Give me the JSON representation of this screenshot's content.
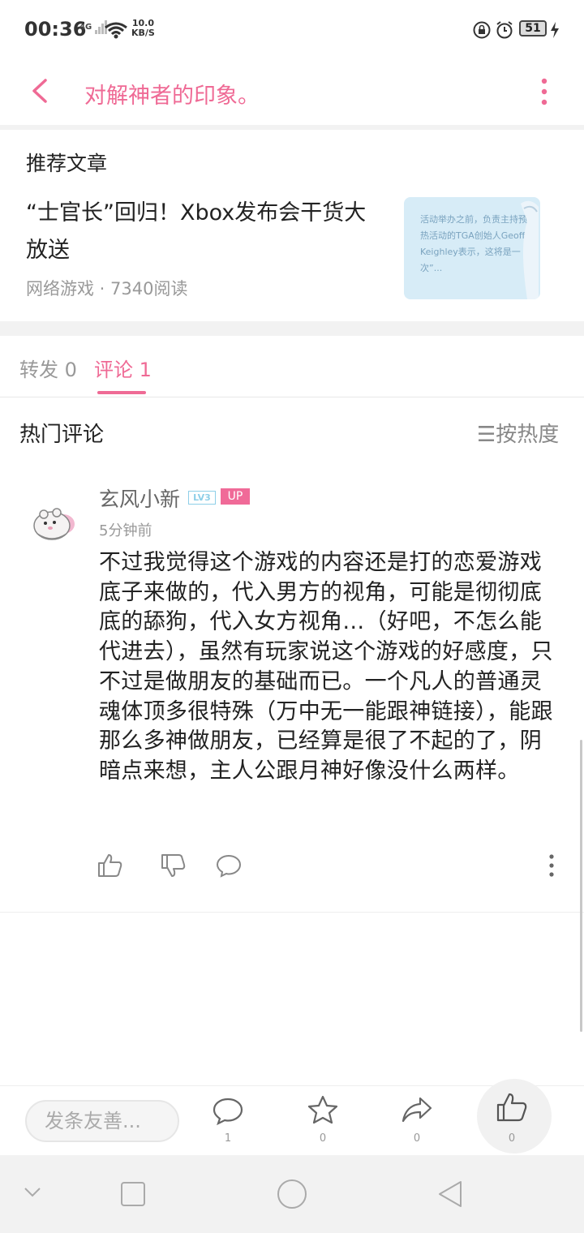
{
  "status_bar": {
    "time": "00:36",
    "network": "4G",
    "speed_value": "10.0",
    "speed_unit": "KB/S",
    "battery": "51"
  },
  "header": {
    "title": "对解神者的印象。",
    "back_icon": "chevron-left-icon",
    "menu_icon": "vertical-dots-icon",
    "accent_color": "#ef6a95"
  },
  "recommended": {
    "heading": "推荐文章",
    "article": {
      "title": "“士官长”回归！Xbox发布会干货大放送",
      "meta": "网络游戏 · 7340阅读",
      "thumbnail_text": "活动举办之前，负责主持预热活动的TGA创始人Geoff Keighley表示，这将是一次”..."
    }
  },
  "tabs": [
    {
      "label": "转发 0",
      "active": false
    },
    {
      "label": "评论 1",
      "active": true
    }
  ],
  "hot_comments": {
    "heading": "热门评论",
    "sort_label": "☰按热度"
  },
  "comment": {
    "username": "玄风小新",
    "level_badge": "LV3",
    "up_badge": "UP",
    "time": "5分钟前",
    "body": "不过我觉得这个游戏的内容还是打的恋爱游戏底子来做的，代入男方的视角，可能是彻彻底底的舔狗，代入女方视角…（好吧，不怎么能代进去），虽然有玩家说这个游戏的好感度，只不过是做朋友的基础而已。一个凡人的普通灵魂体顶多很特殊（万中无一能跟神链接），能跟那么多神做朋友，已经算是很了不起的了，阴暗点来想，主人公跟月神好像没什么两样。"
  },
  "bottom_bar": {
    "input_placeholder": "发条友善...",
    "comment_count": "1",
    "favorite_count": "0",
    "share_count": "0",
    "like_count": "0"
  }
}
